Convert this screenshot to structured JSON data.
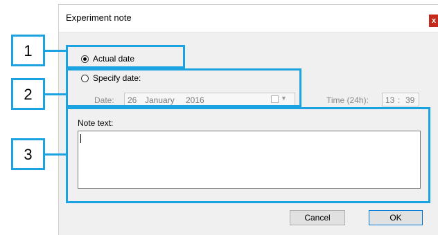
{
  "dialog": {
    "title": "Experiment note",
    "close_label": "x"
  },
  "options": {
    "actual_date_label": "Actual date",
    "specify_date_label": "Specify date:",
    "selected": "Actual date"
  },
  "date": {
    "label": "Date:",
    "day": "26",
    "month": "January",
    "year": "2016"
  },
  "time": {
    "label": "Time (24h):",
    "hour": "13",
    "separator": ":",
    "minute": "39"
  },
  "note": {
    "label": "Note text:",
    "value": ""
  },
  "buttons": {
    "cancel_label": "Cancel",
    "ok_label": "OK"
  },
  "callouts": {
    "one": "1",
    "two": "2",
    "three": "3"
  },
  "colors": {
    "callout_blue": "#1aa3e0",
    "dialog_bg": "#f0f0f0",
    "close_red": "#c42b1c"
  }
}
